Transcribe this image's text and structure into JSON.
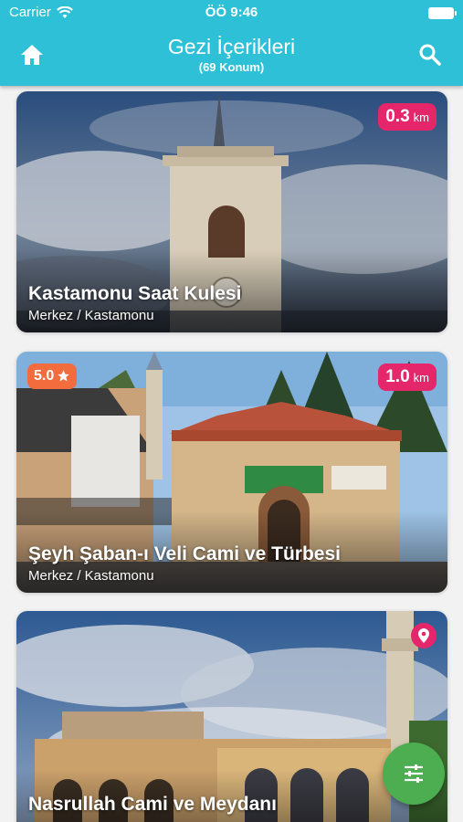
{
  "status_bar": {
    "carrier": "Carrier",
    "time": "ÖÖ 9:46"
  },
  "header": {
    "title": "Gezi İçerikleri",
    "subtitle": "(69 Konum)"
  },
  "cards": [
    {
      "title": "Kastamonu Saat Kulesi",
      "location": "Merkez / Kastamonu",
      "distance": "0.3",
      "unit": "km"
    },
    {
      "title": "Şeyh Şaban-ı Veli Cami ve Türbesi",
      "location": "Merkez / Kastamonu",
      "distance": "1.0",
      "unit": "km",
      "rating": "5.0"
    },
    {
      "title": "Nasrullah Cami ve Meydanı"
    }
  ],
  "colors": {
    "header": "#2ec0d6",
    "distance_badge": "#e5266b",
    "rating_badge": "#f26c3d",
    "fab": "#4cae50"
  },
  "icons": {
    "home": "home-icon",
    "search": "search-icon",
    "filter": "sliders-icon",
    "location": "location-pin-icon",
    "star": "star-icon"
  }
}
